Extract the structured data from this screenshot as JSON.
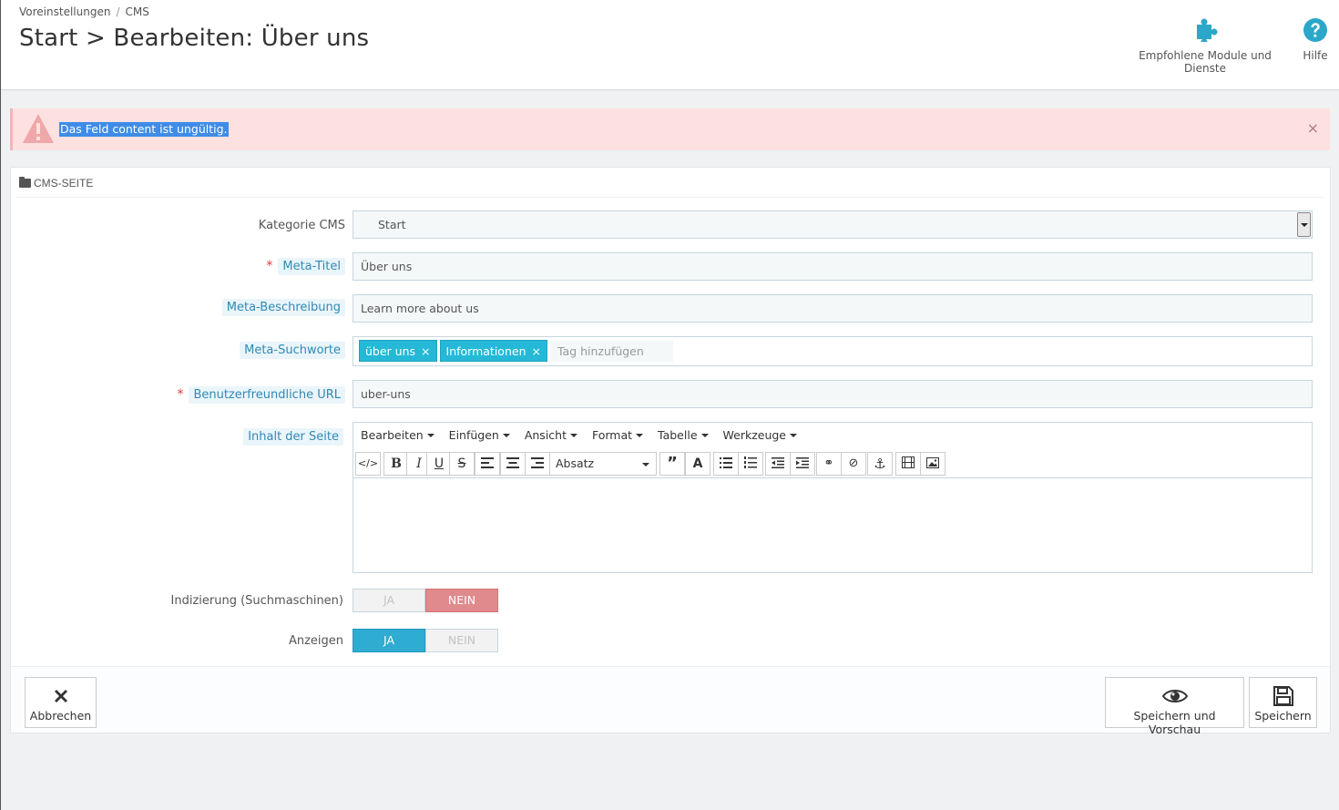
{
  "breadcrumb": {
    "item1": "Voreinstellungen",
    "separator": "/",
    "item2": "CMS"
  },
  "page_title": "Start > Bearbeiten: Über uns",
  "toolbar": {
    "modules_label": "Empfohlene Module und Dienste",
    "help_label": "Hilfe"
  },
  "alert": {
    "message": "Das Feld content ist ungültig.",
    "close": "×"
  },
  "panel": {
    "heading": "CMS-SEITE"
  },
  "form": {
    "category": {
      "label": "Kategorie CMS",
      "value": "Start"
    },
    "meta_title": {
      "required": "*",
      "label": "Meta-Titel",
      "value": "Über uns"
    },
    "meta_description": {
      "label": "Meta-Beschreibung",
      "value": "Learn more about us"
    },
    "meta_keywords": {
      "label": "Meta-Suchworte",
      "tags": [
        "über uns",
        "Informationen"
      ],
      "remove": "×",
      "placeholder": "Tag hinzufügen"
    },
    "friendly_url": {
      "required": "*",
      "label": "Benutzerfreundliche URL",
      "value": "uber-uns"
    },
    "content": {
      "label": "Inhalt der Seite",
      "menus": [
        "Bearbeiten",
        "Einfügen",
        "Ansicht",
        "Format",
        "Tabelle",
        "Werkzeuge"
      ],
      "format_select": "Absatz"
    },
    "indexation": {
      "label": "Indizierung (Suchmaschinen)",
      "yes": "JA",
      "no": "NEIN",
      "selected": "NEIN"
    },
    "display": {
      "label": "Anzeigen",
      "yes": "JA",
      "no": "NEIN",
      "selected": "JA"
    }
  },
  "footer": {
    "cancel": "Abbrechen",
    "save_preview": "Speichern und Vorschau",
    "save": "Speichern"
  },
  "colors": {
    "accent": "#25b9d7",
    "danger_bg": "#fde1e1",
    "switch_no": "#e08a8d",
    "switch_yes": "#2eacd1"
  }
}
